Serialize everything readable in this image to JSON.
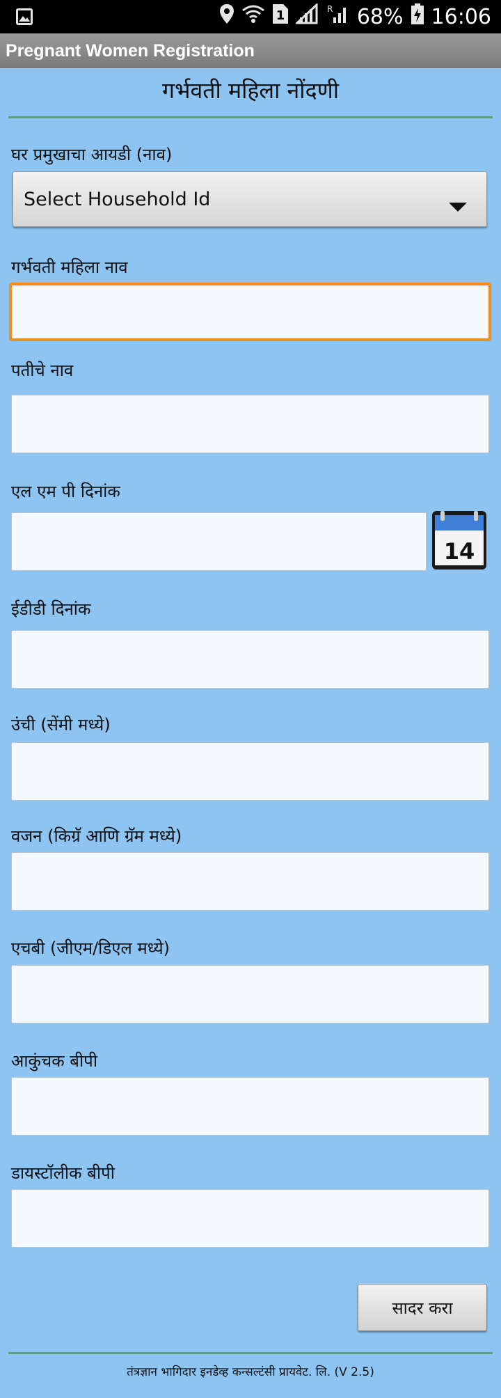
{
  "status_bar": {
    "battery_percent": "68%",
    "time": "16:06",
    "sim_slot": "1",
    "icons": [
      "image-icon",
      "location-icon",
      "wifi-icon",
      "sim-icon",
      "signal-icon",
      "signal-roaming-icon",
      "battery-charging-icon"
    ]
  },
  "app": {
    "title": "Pregnant Women Registration"
  },
  "form": {
    "heading": "गर्भवती महिला नोंदणी",
    "household": {
      "label": "घर प्रमुखाचा आयडी (नाव)",
      "selected": "Select Household Id"
    },
    "woman_name": {
      "label": "गर्भवती महिला नाव",
      "value": ""
    },
    "husband_name": {
      "label": "पतीचे नाव",
      "value": ""
    },
    "lmp_date": {
      "label": "एल एम पी दिनांक",
      "value": "",
      "calendar_day": "14"
    },
    "edd_date": {
      "label": "ईडीडी दिनांक",
      "value": ""
    },
    "height": {
      "label": "उंची (सेंमी मध्ये)",
      "value": ""
    },
    "weight": {
      "label": "वजन (किग्रॅ आणि ग्रॅम मध्ये)",
      "value": ""
    },
    "hb": {
      "label": "एचबी (जीएम/डिएल मध्ये)",
      "value": ""
    },
    "systolic_bp": {
      "label": "आकुंचक बीपी",
      "value": ""
    },
    "diastolic_bp": {
      "label": "डायस्टॉलीक बीपी",
      "value": ""
    },
    "submit_label": "सादर करा"
  },
  "footer": {
    "text": "तंत्रज्ञान भागिदार इनडेव्ह कन्सल्टंसी प्रायवेट. लि. (V 2.5)"
  },
  "colors": {
    "background": "#8dc4f2",
    "focus_border": "#f28c1c",
    "divider": "#5aa07c"
  }
}
